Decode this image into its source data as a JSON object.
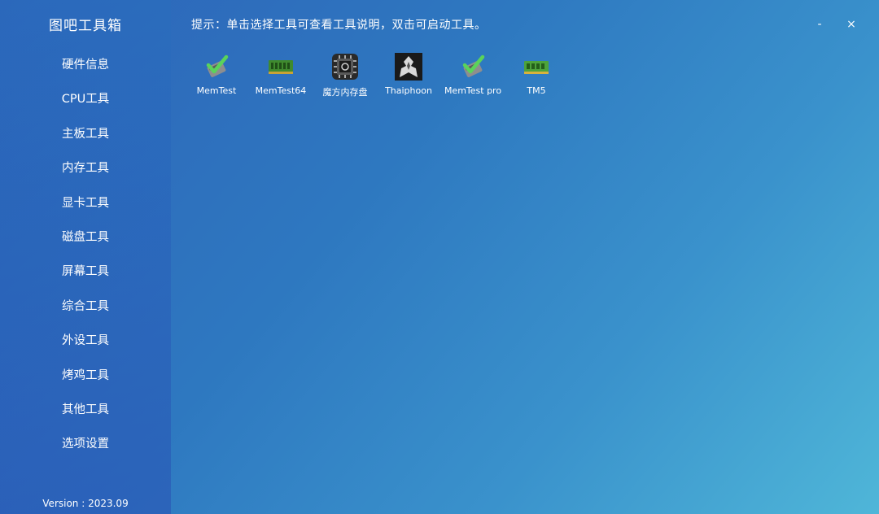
{
  "app": {
    "title": "图吧工具箱",
    "version": "Version : 2023.09"
  },
  "hint": "提示：单击选择工具可查看工具说明，双击可启动工具。",
  "window": {
    "minimize": "-",
    "close": "×"
  },
  "sidebar": {
    "items": [
      {
        "label": "硬件信息"
      },
      {
        "label": "CPU工具"
      },
      {
        "label": "主板工具"
      },
      {
        "label": "内存工具"
      },
      {
        "label": "显卡工具"
      },
      {
        "label": "磁盘工具"
      },
      {
        "label": "屏幕工具"
      },
      {
        "label": "综合工具"
      },
      {
        "label": "外设工具"
      },
      {
        "label": "烤鸡工具"
      },
      {
        "label": "其他工具"
      },
      {
        "label": "选项设置"
      }
    ]
  },
  "tools": [
    {
      "label": "MemTest",
      "icon": "memtest-icon"
    },
    {
      "label": "MemTest64",
      "icon": "ram-module-icon"
    },
    {
      "label": "魔方内存盘",
      "icon": "ramdisk-chip-icon"
    },
    {
      "label": "Thaiphoon",
      "icon": "thaiphoon-icon"
    },
    {
      "label": "MemTest pro",
      "icon": "memtest-pro-icon"
    },
    {
      "label": "TM5",
      "icon": "tm5-ram-icon"
    }
  ]
}
